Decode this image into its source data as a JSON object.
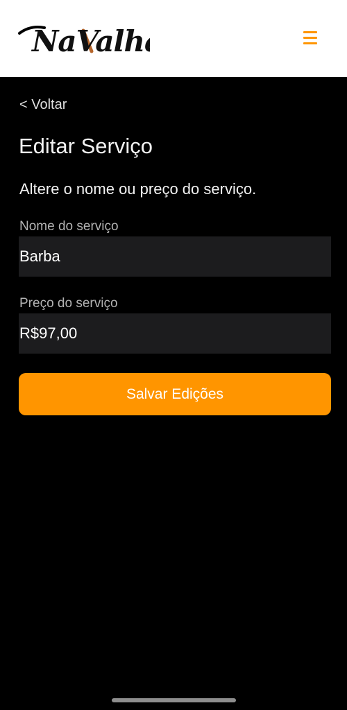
{
  "header": {
    "logo_text": "NaValha",
    "menu_icon": "hamburger-menu-icon",
    "accent_color": "#ff9500"
  },
  "nav": {
    "back_label": "< Voltar"
  },
  "main": {
    "title": "Editar Serviço",
    "subtitle": "Altere o nome ou preço do serviço.",
    "fields": [
      {
        "label": "Nome do serviço",
        "value": "Barba"
      },
      {
        "label": "Preço do serviço",
        "value": "R$97,00"
      }
    ],
    "save_label": "Salvar Edições"
  }
}
